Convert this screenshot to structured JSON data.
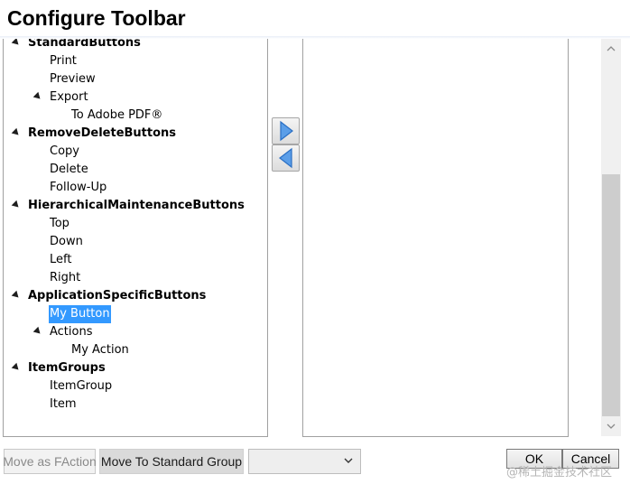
{
  "window": {
    "title": "Configure Toolbar"
  },
  "tree": [
    {
      "label": "StandardButtons",
      "level": 0,
      "group": true,
      "expanded": true
    },
    {
      "label": "Print",
      "level": 1
    },
    {
      "label": "Preview",
      "level": 1
    },
    {
      "label": "Export",
      "level": 1,
      "expanded": true
    },
    {
      "label": "To Adobe PDF®",
      "level": 2
    },
    {
      "label": "RemoveDeleteButtons",
      "level": 0,
      "group": true,
      "expanded": true
    },
    {
      "label": "Copy",
      "level": 1
    },
    {
      "label": "Delete",
      "level": 1
    },
    {
      "label": "Follow-Up",
      "level": 1
    },
    {
      "label": "HierarchicalMaintenanceButtons",
      "level": 0,
      "group": true,
      "expanded": true
    },
    {
      "label": "Top",
      "level": 1
    },
    {
      "label": "Down",
      "level": 1
    },
    {
      "label": "Left",
      "level": 1
    },
    {
      "label": "Right",
      "level": 1
    },
    {
      "label": "ApplicationSpecificButtons",
      "level": 0,
      "group": true,
      "expanded": true
    },
    {
      "label": "My Button",
      "level": 1,
      "selected": true
    },
    {
      "label": "Actions",
      "level": 1,
      "expanded": true
    },
    {
      "label": "My Action",
      "level": 2
    },
    {
      "label": "ItemGroups",
      "level": 0,
      "group": true,
      "expanded": true
    },
    {
      "label": "ItemGroup",
      "level": 1
    },
    {
      "label": "Item",
      "level": 1
    }
  ],
  "buttons": {
    "move_as_faction": "Move as FAction",
    "move_to_standard_group": "Move To Standard Group",
    "ok": "OK",
    "cancel": "Cancel"
  },
  "dropdown": {
    "selected": ""
  },
  "watermark": "@稀土掘金技术社区",
  "colors": {
    "selection": "#3399ff",
    "arrow": "#4a90e2"
  }
}
